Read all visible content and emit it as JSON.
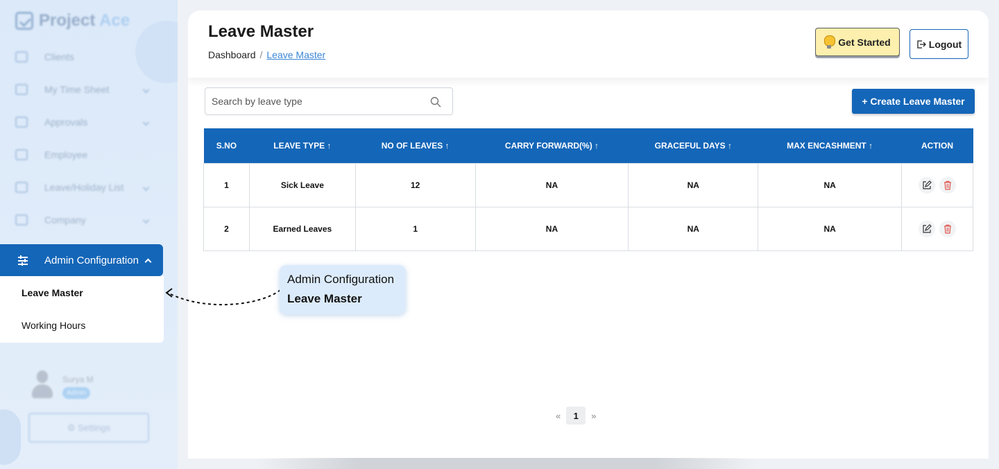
{
  "sidebar": {
    "logo": {
      "part1": "Project",
      "part2": "Ace"
    },
    "items": [
      {
        "label": "Clients"
      },
      {
        "label": "My Time Sheet"
      },
      {
        "label": "Approvals"
      },
      {
        "label": "Employee"
      },
      {
        "label": "Leave/Holiday List"
      },
      {
        "label": "Company"
      }
    ],
    "active_section": "Admin Configuration",
    "submenu": [
      {
        "label": "Leave Master"
      },
      {
        "label": "Working Hours"
      }
    ],
    "user": {
      "name": "Surya M",
      "role": "Admin"
    },
    "settings_label": "⚙ Settings"
  },
  "header": {
    "title": "Leave Master",
    "breadcrumb": {
      "root": "Dashboard",
      "sep": "/",
      "current": "Leave Master"
    },
    "get_started": "Get Started",
    "logout": "Logout"
  },
  "search": {
    "placeholder": "Search by leave type"
  },
  "create_button": "+ Create Leave Master",
  "table": {
    "columns": [
      "S.NO",
      "LEAVE TYPE ↑",
      "NO OF LEAVES ↑",
      "CARRY FORWARD(%) ↑",
      "GRACEFUL DAYS ↑",
      "MAX ENCASHMENT ↑",
      "ACTION"
    ],
    "rows": [
      [
        "1",
        "Sick Leave",
        "12",
        "NA",
        "NA",
        "NA"
      ],
      [
        "2",
        "Earned Leaves",
        "1",
        "NA",
        "NA",
        "NA"
      ]
    ]
  },
  "pagination": {
    "prev": "«",
    "page": "1",
    "next": "»"
  },
  "callout": {
    "line1": "Admin Configuration",
    "line2": "Leave Master"
  },
  "colors": {
    "primary": "#1466b8",
    "accent": "#fdefad"
  }
}
